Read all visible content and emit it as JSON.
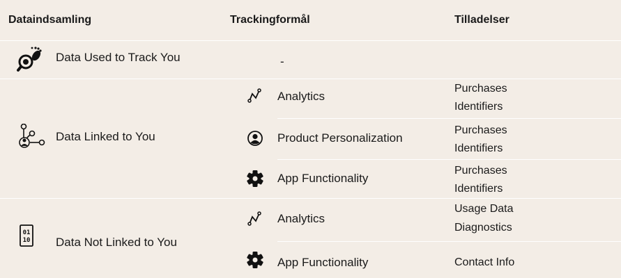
{
  "header": {
    "col1": "Dataindsamling",
    "col2": "Trackingformål",
    "col3": "Tilladelser"
  },
  "sections": [
    {
      "label": "Data Used to Track You",
      "icon": "footprint-magnifier-icon",
      "purpose_placeholder": "-"
    },
    {
      "label": "Data Linked to You",
      "icon": "person-network-icon",
      "purposes": [
        {
          "icon": "analytics-icon",
          "label": "Analytics",
          "permissions": [
            "Purchases",
            "Identifiers"
          ]
        },
        {
          "icon": "user-circle-icon",
          "label": "Product Personalization",
          "permissions": [
            "Purchases",
            "Identifiers"
          ]
        },
        {
          "icon": "gear-icon",
          "label": "App Functionality",
          "permissions": [
            "Purchases",
            "Identifiers"
          ]
        }
      ]
    },
    {
      "label": "Data Not Linked to You",
      "icon": "binary-code-icon",
      "purposes": [
        {
          "icon": "analytics-icon",
          "label": "Analytics",
          "permissions": [
            "Usage Data",
            "Diagnostics"
          ]
        },
        {
          "icon": "gear-icon",
          "label": "App Functionality",
          "permissions": [
            "Contact Info"
          ]
        }
      ]
    }
  ],
  "colors": {
    "background": "#f3ede6",
    "separator": "#ffffff",
    "text": "#1a1a1a"
  }
}
